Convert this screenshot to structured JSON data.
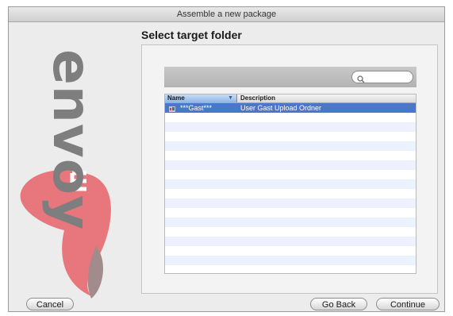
{
  "window": {
    "title": "Assemble a new package"
  },
  "logo": {
    "text": "envoy",
    "colors": {
      "primary": "#e8767d",
      "secondary": "#a28b8b",
      "text": "#7e7e7e"
    }
  },
  "main": {
    "heading": "Select target folder",
    "search": {
      "placeholder": "",
      "icon": "search-icon"
    },
    "table": {
      "columns": [
        "Name",
        "Description"
      ],
      "sort_column": "Name",
      "rows": [
        {
          "name": "***Gast***",
          "description": "User Gast Upload Ordner",
          "selected": true,
          "icon": "folder-icon"
        }
      ],
      "empty_rows": 17
    }
  },
  "footer": {
    "cancel_label": "Cancel",
    "back_label": "Go Back",
    "continue_label": "Continue"
  },
  "colors": {
    "selection": "#4a78c9",
    "stripe": "#edf3fe",
    "window_bg": "#ececec"
  }
}
